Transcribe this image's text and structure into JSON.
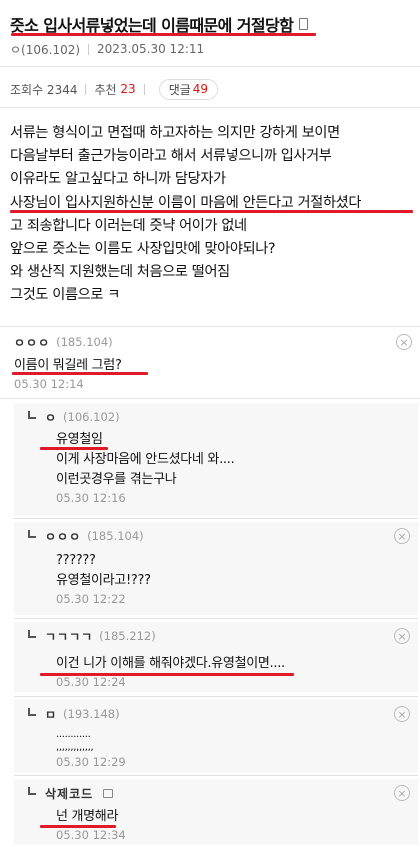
{
  "post": {
    "title": "즛소 입사서류넣었는데 이름때문에 거절당함",
    "author": "ㅇ(106.102)",
    "datetime": "2023.05.30 12:11",
    "views_label": "조회수 2344",
    "recommend_label": "추천",
    "recommend_count": "23",
    "comment_label": "댓글",
    "comment_count": "49",
    "body": [
      "서류는 형식이고 면접때 하고자하는 의지만 강하게 보이면",
      "다음날부터 출근가능이라고 해서 서류넣으니까 입사거부",
      "이유라도 알고싶다고 하니까 담당자가",
      "사장님이 입사지원하신분 이름이 마음에 안든다고 거절하셨다",
      "고 죄송합니다 이러는데 즛냑 어이가 없네",
      "앞으로 즛소는 이름도 사장입맛에 맞아야되나?",
      "와 생산직 지원했는데 처음으로 떨어짐",
      "그것도 이름으로 ㅋ"
    ]
  },
  "comments": [
    {
      "author": "ㅇㅇㅇ",
      "ip": "(185.104)",
      "text": [
        "이름이 뭐길레 그럼?"
      ],
      "date": "05.30 12:14",
      "close": "×"
    },
    {
      "author": "ㅇ",
      "ip": "(106.102)",
      "text": [
        "유영철임",
        "이게 사장마음에 안드셨다네 와....",
        "이런곳경우를 겪는구나"
      ],
      "date": "05.30 12:16"
    },
    {
      "author": "ㅇㅇㅇ",
      "ip": "(185.104)",
      "text": [
        "??????",
        "유영철이라고!???"
      ],
      "date": "05.30 12:22",
      "close": "×"
    },
    {
      "author": "ㄱㄱㄱㄱ",
      "ip": "(185.212)",
      "text": [
        "이건 니가 이해를 해줘야겠다.유영철이면...."
      ],
      "date": "05.30 12:24",
      "close": "×"
    },
    {
      "author": "ㅁ",
      "ip": "(193.148)",
      "text": [
        "............",
        ",,,,,,,,,,,,,"
      ],
      "date": "05.30 12:29",
      "close": "×"
    },
    {
      "author": "삭제코드",
      "ip": "",
      "text": [
        "넌 개명해라"
      ],
      "date": "05.30 12:34",
      "close": "×"
    }
  ],
  "colors": {
    "accent_red": "#e0192b",
    "reply_bg": "#f7f7f7"
  }
}
